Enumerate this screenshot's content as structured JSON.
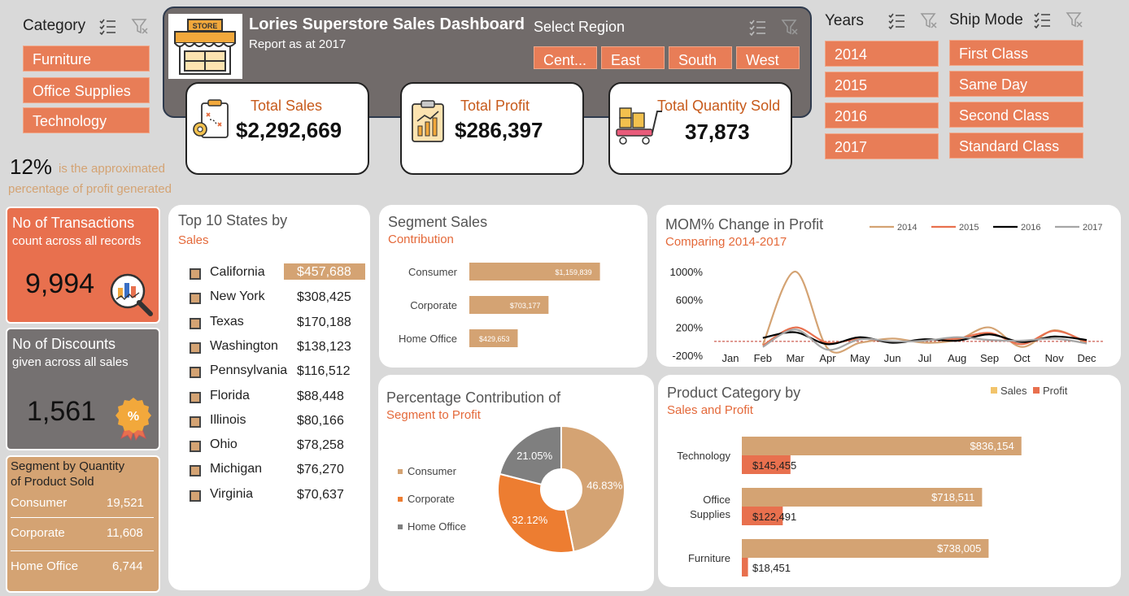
{
  "category_slicer": {
    "title": "Category",
    "items": [
      "Furniture",
      "Office Supplies",
      "Technology"
    ]
  },
  "header": {
    "store_sign": "STORE",
    "title": "Lories Superstore Sales Dashboard",
    "subtitle": "Report as at 2017"
  },
  "region_slicer": {
    "title": "Select Region",
    "items": [
      "Cent...",
      "East",
      "South",
      "West"
    ]
  },
  "years_slicer": {
    "title": "Years",
    "items": [
      "2014",
      "2015",
      "2016",
      "2017"
    ]
  },
  "shipmode_slicer": {
    "title": "Ship Mode",
    "items": [
      "First Class",
      "Same Day",
      "Second Class",
      "Standard Class"
    ]
  },
  "kpis": {
    "sales": {
      "label": "Total Sales",
      "value": "$2,292,669"
    },
    "profit": {
      "label": "Total Profit",
      "value": "$286,397"
    },
    "quantity": {
      "label": "Total Quantity Sold",
      "value": "37,873"
    }
  },
  "profit_note": {
    "pct": "12%",
    "text_a": "is the approximated",
    "text_b": "percentage of profit generated"
  },
  "transactions": {
    "title": "No of Transactions",
    "subtitle": "count across all records",
    "value": "9,994"
  },
  "discounts": {
    "title": "No of Discounts",
    "subtitle": "given across all sales",
    "value": "1,561"
  },
  "segment_qty": {
    "title_a": "Segment by Quantity",
    "title_b": "of Product Sold",
    "rows": [
      {
        "name": "Consumer",
        "value": "19,521"
      },
      {
        "name": "Corporate",
        "value": "11,608"
      },
      {
        "name": "Home Office",
        "value": "6,744"
      }
    ]
  },
  "colors": {
    "tan": "#d4a373",
    "orange": "#e87d57",
    "burnt": "#ed7d31",
    "grey": "#7f7f7f",
    "dark": "#6f6b6a"
  },
  "chart_data": [
    {
      "id": "top_states",
      "type": "table",
      "title": "Top 10 States by",
      "subtitle": "Sales",
      "rows": [
        {
          "state": "California",
          "sales": 457688,
          "label": "$457,688",
          "highlight": true
        },
        {
          "state": "New York",
          "sales": 308425,
          "label": "$308,425"
        },
        {
          "state": "Texas",
          "sales": 170188,
          "label": "$170,188"
        },
        {
          "state": "Washington",
          "sales": 138123,
          "label": "$138,123"
        },
        {
          "state": "Pennsylvania",
          "sales": 116512,
          "label": "$116,512"
        },
        {
          "state": "Florida",
          "sales": 88448,
          "label": "$88,448"
        },
        {
          "state": "Illinois",
          "sales": 80166,
          "label": "$80,166"
        },
        {
          "state": "Ohio",
          "sales": 78258,
          "label": "$78,258"
        },
        {
          "state": "Michigan",
          "sales": 76270,
          "label": "$76,270"
        },
        {
          "state": "Virginia",
          "sales": 70637,
          "label": "$70,637"
        }
      ]
    },
    {
      "id": "segment_sales",
      "type": "bar",
      "orientation": "horizontal",
      "title": "Segment Sales",
      "subtitle": "Contribution",
      "categories": [
        "Consumer",
        "Corporate",
        "Home Office"
      ],
      "values": [
        1159839,
        703177,
        429653
      ],
      "labels": [
        "$1,159,839",
        "$703,177",
        "$429,653"
      ],
      "xlim": [
        0,
        1300000
      ]
    },
    {
      "id": "mom_profit",
      "type": "line",
      "title": "MOM% Change in Profit",
      "subtitle": "Comparing 2014-2017",
      "x": [
        "Jan",
        "Feb",
        "Mar",
        "Apr",
        "May",
        "Jun",
        "Jul",
        "Aug",
        "Sep",
        "Oct",
        "Nov",
        "Dec"
      ],
      "ylim": [
        -200,
        1000
      ],
      "yticks": [
        1000,
        600,
        200,
        -200
      ],
      "ytick_labels": [
        "1000%",
        "600%",
        "200%",
        "-200%"
      ],
      "baseline": 0,
      "legend_position": "top-right",
      "series": [
        {
          "name": "2014",
          "values": [
            null,
            -50,
            1000,
            -100,
            -20,
            40,
            -20,
            20,
            200,
            -80,
            160,
            -30
          ]
        },
        {
          "name": "2015",
          "values": [
            null,
            -60,
            200,
            -20,
            40,
            -10,
            20,
            40,
            120,
            -40,
            150,
            -10
          ]
        },
        {
          "name": "2016",
          "values": [
            null,
            50,
            130,
            -40,
            60,
            -20,
            30,
            10,
            100,
            -10,
            70,
            20
          ]
        },
        {
          "name": "2017",
          "values": [
            null,
            -80,
            170,
            -120,
            30,
            0,
            10,
            60,
            20,
            10,
            40,
            -30
          ]
        }
      ]
    },
    {
      "id": "pct_segment_profit",
      "type": "pie",
      "donut": true,
      "title": "Percentage Contribution of",
      "subtitle": "Segment to Profit",
      "categories": [
        "Consumer",
        "Corporate",
        "Home Office"
      ],
      "values": [
        46.83,
        32.12,
        21.05
      ],
      "labels": [
        "46.83%",
        "32.12%",
        "21.05%"
      ]
    },
    {
      "id": "category_sales_profit",
      "type": "bar",
      "orientation": "horizontal",
      "title": "Product Category by",
      "subtitle": "Sales and Profit",
      "categories": [
        "Technology",
        "Office Supplies",
        "Furniture"
      ],
      "legend_position": "top-right",
      "series": [
        {
          "name": "Sales",
          "values": [
            836154,
            718511,
            738005
          ],
          "labels": [
            "$836,154",
            "$718,511",
            "$738,005"
          ]
        },
        {
          "name": "Profit",
          "values": [
            145455,
            122491,
            18451
          ],
          "labels": [
            "$145,455",
            "$122,491",
            "$18,451"
          ]
        }
      ],
      "xlim": [
        0,
        900000
      ]
    }
  ]
}
